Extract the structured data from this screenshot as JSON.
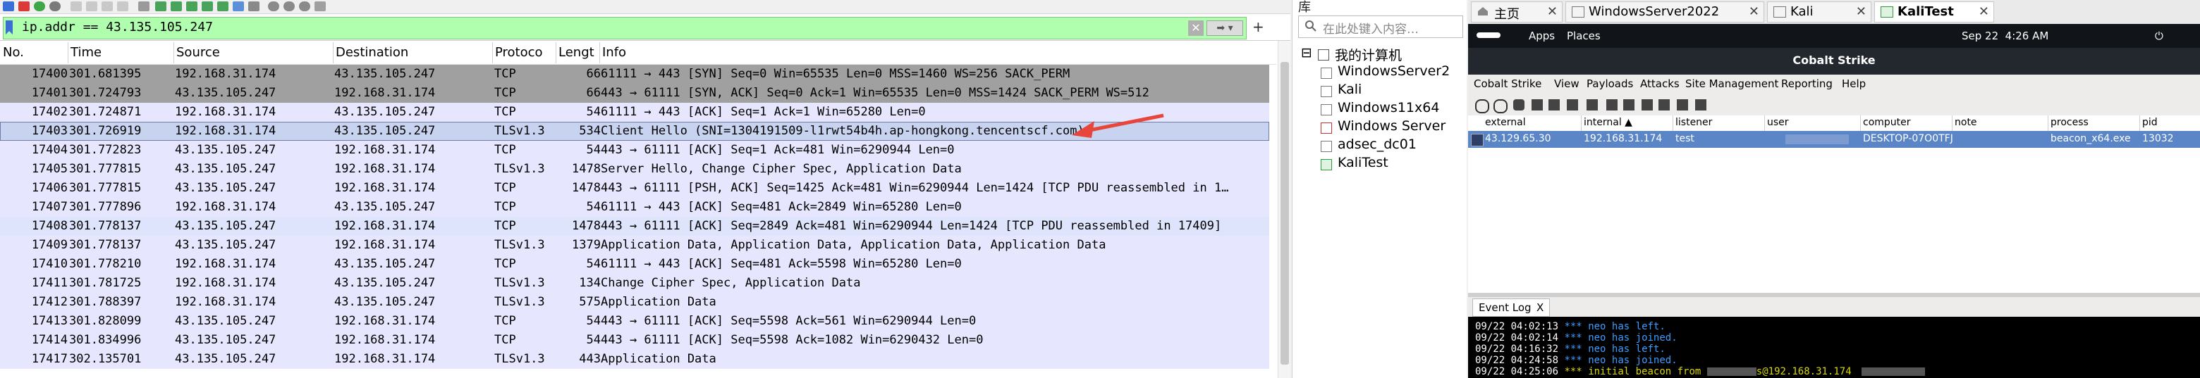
{
  "wireshark": {
    "filter": {
      "value": "ip.addr == 43.135.105.247"
    },
    "columns": [
      "No.",
      "Time",
      "Source",
      "Destination",
      "Protoco",
      "Lengt",
      "Info"
    ],
    "colors": {
      "gray": "#a0a0a0",
      "lavender": "#e7e6ff",
      "selected_row": "#c8d3f0",
      "filter_bg": "#afffaf"
    },
    "rows": [
      {
        "no": "17400",
        "time": "301.681395",
        "src": "192.168.31.174",
        "dst": "43.135.105.247",
        "proto": "TCP",
        "len": "66",
        "info": "61111 → 443 [SYN] Seq=0 Win=65535 Len=0 MSS=1460 WS=256 SACK_PERM",
        "style": "gray"
      },
      {
        "no": "17401",
        "time": "301.724793",
        "src": "43.135.105.247",
        "dst": "192.168.31.174",
        "proto": "TCP",
        "len": "66",
        "info": "443 → 61111 [SYN, ACK] Seq=0 Ack=1 Win=65535 Len=0 MSS=1424 SACK_PERM WS=512",
        "style": "gray"
      },
      {
        "no": "17402",
        "time": "301.724871",
        "src": "192.168.31.174",
        "dst": "43.135.105.247",
        "proto": "TCP",
        "len": "54",
        "info": "61111 → 443 [ACK] Seq=1 Ack=1 Win=65280 Len=0",
        "style": "lavender"
      },
      {
        "no": "17403",
        "time": "301.726919",
        "src": "192.168.31.174",
        "dst": "43.135.105.247",
        "proto": "TLSv1.3",
        "len": "534",
        "info": "Client Hello (SNI=1304191509-l1rwt54b4h.ap-hongkong.tencentscf.com)",
        "style": "selected"
      },
      {
        "no": "17404",
        "time": "301.772823",
        "src": "43.135.105.247",
        "dst": "192.168.31.174",
        "proto": "TCP",
        "len": "54",
        "info": "443 → 61111 [ACK] Seq=1 Ack=481 Win=6290944 Len=0",
        "style": "lavender"
      },
      {
        "no": "17405",
        "time": "301.777815",
        "src": "43.135.105.247",
        "dst": "192.168.31.174",
        "proto": "TLSv1.3",
        "len": "1478",
        "info": "Server Hello, Change Cipher Spec, Application Data",
        "style": "lavender"
      },
      {
        "no": "17406",
        "time": "301.777815",
        "src": "43.135.105.247",
        "dst": "192.168.31.174",
        "proto": "TCP",
        "len": "1478",
        "info": "443 → 61111 [PSH, ACK] Seq=1425 Ack=481 Win=6290944 Len=1424 [TCP PDU reassembled in 1…",
        "style": "lavender"
      },
      {
        "no": "17407",
        "time": "301.777896",
        "src": "192.168.31.174",
        "dst": "43.135.105.247",
        "proto": "TCP",
        "len": "54",
        "info": "61111 → 443 [ACK] Seq=481 Ack=2849 Win=65280 Len=0",
        "style": "lavender"
      },
      {
        "no": "17408",
        "time": "301.778137",
        "src": "43.135.105.247",
        "dst": "192.168.31.174",
        "proto": "TCP",
        "len": "1478",
        "info": "443 → 61111 [ACK] Seq=2849 Ack=481 Win=6290944 Len=1424 [TCP PDU reassembled in 17409]",
        "style": "hover"
      },
      {
        "no": "17409",
        "time": "301.778137",
        "src": "43.135.105.247",
        "dst": "192.168.31.174",
        "proto": "TLSv1.3",
        "len": "1379",
        "info": "Application Data, Application Data, Application Data, Application Data",
        "style": "lavender"
      },
      {
        "no": "17410",
        "time": "301.778210",
        "src": "192.168.31.174",
        "dst": "43.135.105.247",
        "proto": "TCP",
        "len": "54",
        "info": "61111 → 443 [ACK] Seq=481 Ack=5598 Win=65280 Len=0",
        "style": "lavender"
      },
      {
        "no": "17411",
        "time": "301.781725",
        "src": "192.168.31.174",
        "dst": "43.135.105.247",
        "proto": "TLSv1.3",
        "len": "134",
        "info": "Change Cipher Spec, Application Data",
        "style": "lavender"
      },
      {
        "no": "17412",
        "time": "301.788397",
        "src": "192.168.31.174",
        "dst": "43.135.105.247",
        "proto": "TLSv1.3",
        "len": "575",
        "info": "Application Data",
        "style": "lavender"
      },
      {
        "no": "17413",
        "time": "301.828099",
        "src": "43.135.105.247",
        "dst": "192.168.31.174",
        "proto": "TCP",
        "len": "54",
        "info": "443 → 61111 [ACK] Seq=5598 Ack=561 Win=6290944 Len=0",
        "style": "lavender"
      },
      {
        "no": "17414",
        "time": "301.834996",
        "src": "43.135.105.247",
        "dst": "192.168.31.174",
        "proto": "TCP",
        "len": "54",
        "info": "443 → 61111 [ACK] Seq=5598 Ack=1082 Win=6290432 Len=0",
        "style": "lavender"
      },
      {
        "no": "17417",
        "time": "302.135701",
        "src": "43.135.105.247",
        "dst": "192.168.31.174",
        "proto": "TLSv1.3",
        "len": "443",
        "info": "Application Data",
        "style": "lavender"
      }
    ]
  },
  "library": {
    "title": "库",
    "search_placeholder": "在此处键入内容…",
    "root": "我的计算机",
    "items": [
      "WindowsServer2",
      "Kali",
      "Windows11x64",
      "Windows Server",
      "adsec_dc01",
      "KaliTest"
    ]
  },
  "vm_tabs": [
    {
      "label": "主页",
      "active": false
    },
    {
      "label": "WindowsServer2022",
      "active": false
    },
    {
      "label": "Kali",
      "active": false
    },
    {
      "label": "KaliTest",
      "active": true
    }
  ],
  "kali_panel": {
    "apps": "Apps",
    "places": "Places",
    "clock": "Sep 22  4:26 AM"
  },
  "cobalt": {
    "title": "Cobalt Strike",
    "menu": [
      "Cobalt Strike",
      "View",
      "Payloads",
      "Attacks",
      "Site Management",
      "Reporting",
      "Help"
    ],
    "columns": [
      "external",
      "internal ▲",
      "listener",
      "user",
      "computer",
      "note",
      "process",
      "pid"
    ],
    "session": {
      "external": "43.129.65.30",
      "internal": "192.168.31.174",
      "listener": "test",
      "user": "",
      "computer": "DESKTOP-07O0TFJ",
      "note": "",
      "process": "beacon_x64.exe",
      "pid": "13032"
    },
    "log_tab": "Event Log",
    "log": [
      {
        "ts": "09/22 04:02:13",
        "star": "***",
        "user": "neo",
        "msg": "has left."
      },
      {
        "ts": "09/22 04:02:14",
        "star": "***",
        "user": "neo",
        "msg": "has joined."
      },
      {
        "ts": "09/22 04:16:32",
        "star": "***",
        "user": "neo",
        "msg": "has left."
      },
      {
        "ts": "09/22 04:24:58",
        "star": "***",
        "user": "neo",
        "msg": "has joined."
      },
      {
        "ts": "09/22 04:25:06",
        "star": "***",
        "user": "",
        "msg": "initial beacon from",
        "tail": "s@192.168.31.174"
      }
    ]
  }
}
